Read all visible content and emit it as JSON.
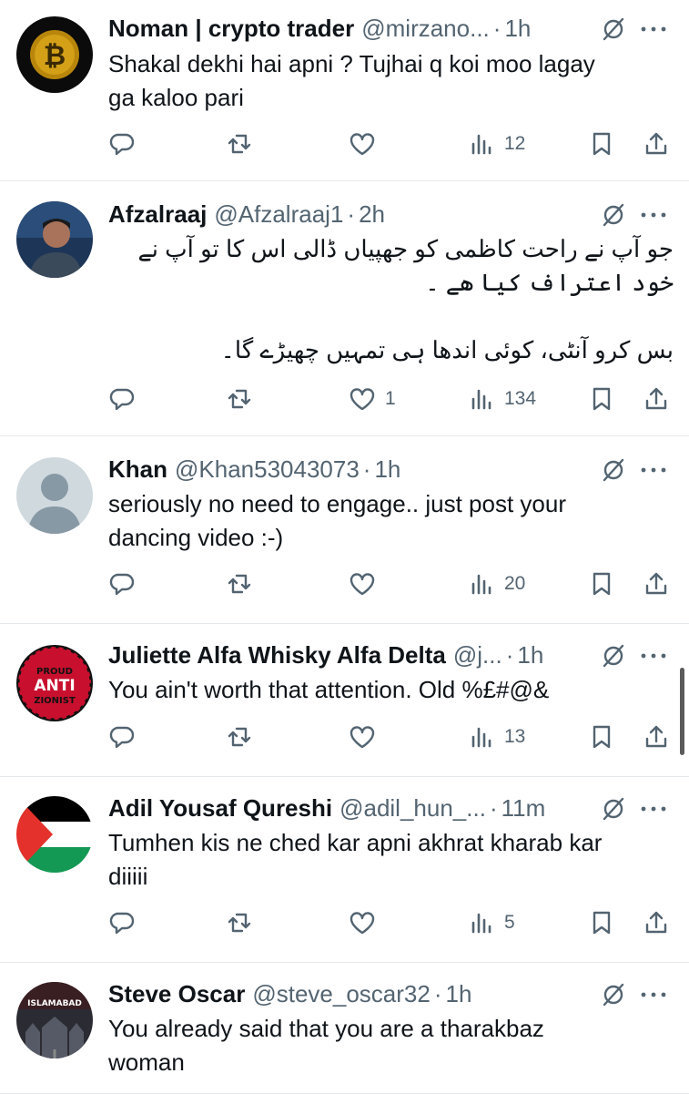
{
  "tweets": [
    {
      "name": "Noman | crypto trader",
      "handle": "@mirzano...",
      "time": "1h",
      "text": [
        "Shakal dekhi hai apni ? Tujhai q koi moo lagay",
        "ga kaloo pari"
      ],
      "rtl": false,
      "avatar": "bitcoin-avatar",
      "likes": "",
      "views": "12"
    },
    {
      "name": "Afzalraaj",
      "handle": "@Afzalraaj1",
      "time": "2h",
      "text": [
        "جو آپ نے راحت کاظمی کو جھپیاں ڈالی اس کا تو آپ نے",
        "خود اعتراف کیا ھے ۔",
        "",
        "بس کرو آنٹی، کوئی اندھا ہی تمہیں چھیڑے گا۔"
      ],
      "rtl": true,
      "avatar": "photo-avatar",
      "likes": "1",
      "views": "134"
    },
    {
      "name": "Khan",
      "handle": "@Khan53043073",
      "time": "1h",
      "text": [
        "seriously no need to engage.. just post your",
        "dancing video :-)"
      ],
      "rtl": false,
      "avatar": "default-avatar",
      "likes": "",
      "views": "20"
    },
    {
      "name": "Juliette Alfa Whisky Alfa Delta",
      "handle": "@j...",
      "time": "1h",
      "text": [
        "You ain't worth that attention. Old %£#@&"
      ],
      "rtl": false,
      "avatar": "proud-anti-zionist-avatar",
      "avatar_text": [
        "PROUD",
        "ANTI",
        "ZIONIST"
      ],
      "likes": "",
      "views": "13"
    },
    {
      "name": "Adil Yousaf Qureshi",
      "handle": "@adil_hun_...",
      "time": "11m",
      "text": [
        "Tumhen kis ne ched kar apni akhrat kharab kar",
        "diiiii"
      ],
      "rtl": false,
      "avatar": "palestine-flag-avatar",
      "likes": "",
      "views": "5"
    },
    {
      "name": "Steve Oscar",
      "handle": "@steve_oscar32",
      "time": "1h",
      "text": [
        "You already said that you are a tharakbaz",
        "woman"
      ],
      "rtl": false,
      "avatar": "islamabad-avatar",
      "avatar_text": [
        "ISLAMABAD"
      ],
      "likes": "",
      "views": ""
    }
  ],
  "separator": "·",
  "colors": {
    "text": "#0f1419",
    "muted": "#536471",
    "divider": "#e6e9ec"
  },
  "icons": [
    "reply-icon",
    "retweet-icon",
    "like-icon",
    "views-icon",
    "bookmark-icon",
    "share-icon",
    "grok-icon",
    "more-icon"
  ]
}
